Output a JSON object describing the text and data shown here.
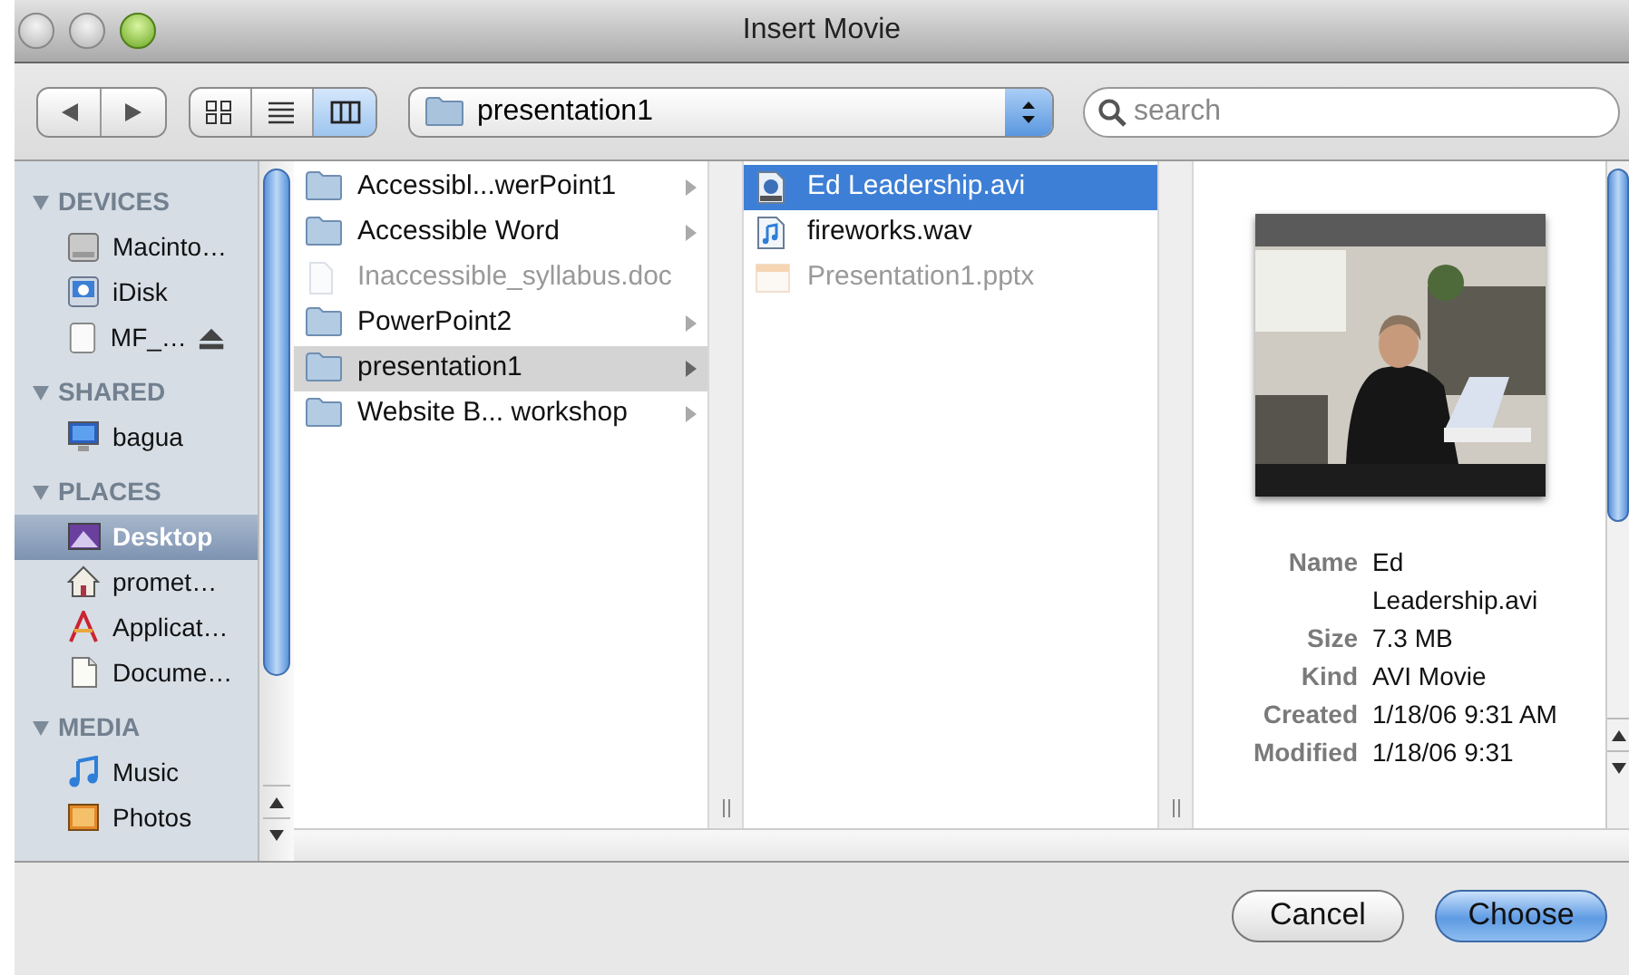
{
  "window": {
    "title": "Insert Movie"
  },
  "toolbar": {
    "nav": [
      {
        "kind": "back",
        "disabled": false
      },
      {
        "kind": "forward",
        "disabled": false
      }
    ],
    "view_modes": [
      {
        "kind": "icons",
        "selected": false
      },
      {
        "kind": "list",
        "selected": false
      },
      {
        "kind": "columns",
        "selected": true
      }
    ],
    "path_popup": {
      "label": "presentation1"
    },
    "search": {
      "placeholder": "search"
    }
  },
  "sidebar": {
    "sections": [
      {
        "title": "DEVICES",
        "expanded": true,
        "items": [
          {
            "label": "Macinto…",
            "kind": "disk",
            "selected": false,
            "ejectable": false
          },
          {
            "label": "iDisk",
            "kind": "idisk",
            "selected": false,
            "ejectable": false
          },
          {
            "label": "MF_…",
            "kind": "drive",
            "selected": false,
            "ejectable": true
          }
        ]
      },
      {
        "title": "SHARED",
        "expanded": true,
        "items": [
          {
            "label": "bagua",
            "kind": "computer",
            "selected": false,
            "ejectable": false
          }
        ]
      },
      {
        "title": "PLACES",
        "expanded": true,
        "items": [
          {
            "label": "Desktop",
            "kind": "desktop",
            "selected": true,
            "ejectable": false
          },
          {
            "label": "promet…",
            "kind": "home",
            "selected": false,
            "ejectable": false
          },
          {
            "label": "Applicat…",
            "kind": "apps",
            "selected": false,
            "ejectable": false
          },
          {
            "label": "Docume…",
            "kind": "documents",
            "selected": false,
            "ejectable": false
          }
        ]
      },
      {
        "title": "MEDIA",
        "expanded": true,
        "items": [
          {
            "label": "Music",
            "kind": "music",
            "selected": false,
            "ejectable": false
          },
          {
            "label": "Photos",
            "kind": "photos",
            "selected": false,
            "ejectable": false
          }
        ]
      }
    ]
  },
  "columns": [
    {
      "focused": false,
      "items": [
        {
          "label": "Accessibl...werPoint1",
          "kind": "folder",
          "selected": false,
          "disabled": false
        },
        {
          "label": "Accessible Word",
          "kind": "folder",
          "selected": false,
          "disabled": false
        },
        {
          "label": "Inaccessible_syllabus.doc",
          "kind": "doc",
          "selected": false,
          "disabled": true
        },
        {
          "label": "PowerPoint2",
          "kind": "folder",
          "selected": false,
          "disabled": false
        },
        {
          "label": "presentation1",
          "kind": "folder",
          "selected": true,
          "disabled": false
        },
        {
          "label": "Website B... workshop",
          "kind": "folder",
          "selected": false,
          "disabled": false
        }
      ]
    },
    {
      "focused": true,
      "items": [
        {
          "label": "Ed Leadership.avi",
          "kind": "movie",
          "selected": true,
          "disabled": false
        },
        {
          "label": "fireworks.wav",
          "kind": "audio",
          "selected": false,
          "disabled": false
        },
        {
          "label": "Presentation1.pptx",
          "kind": "pptx",
          "selected": false,
          "disabled": true
        }
      ]
    }
  ],
  "preview": {
    "kind": "picture",
    "fields": [
      {
        "label": "Name",
        "value": "Ed Leadership.avi"
      },
      {
        "label": "Size",
        "value": "7.3 MB"
      },
      {
        "label": "Kind",
        "value": "AVI Movie"
      },
      {
        "label": "Created",
        "value": "1/18/06 9:31 AM"
      },
      {
        "label": "Modified",
        "value": "1/18/06 9:31"
      }
    ]
  },
  "buttons": [
    {
      "label": "Cancel",
      "default": false
    },
    {
      "label": "Choose",
      "default": true
    }
  ]
}
